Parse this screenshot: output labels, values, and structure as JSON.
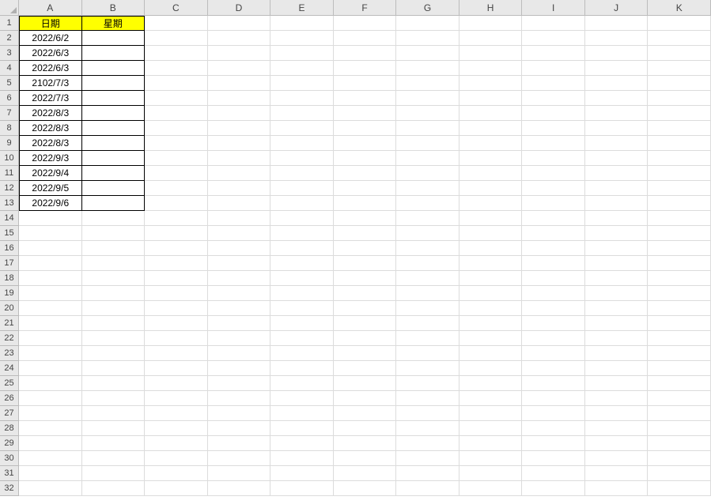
{
  "columns": [
    "A",
    "B",
    "C",
    "D",
    "E",
    "F",
    "G",
    "H",
    "I",
    "J",
    "K"
  ],
  "total_rows": 32,
  "headers": {
    "A": "日期",
    "B": "星期"
  },
  "rows": [
    {
      "A": "2022/6/2",
      "B": ""
    },
    {
      "A": "2022/6/3",
      "B": ""
    },
    {
      "A": "2022/6/3",
      "B": ""
    },
    {
      "A": "2102/7/3",
      "B": ""
    },
    {
      "A": "2022/7/3",
      "B": ""
    },
    {
      "A": "2022/8/3",
      "B": ""
    },
    {
      "A": "2022/8/3",
      "B": ""
    },
    {
      "A": "2022/8/3",
      "B": ""
    },
    {
      "A": "2022/9/3",
      "B": ""
    },
    {
      "A": "2022/9/4",
      "B": ""
    },
    {
      "A": "2022/9/5",
      "B": ""
    },
    {
      "A": "2022/9/6",
      "B": ""
    }
  ],
  "chart_data": {
    "type": "table",
    "title": "",
    "columns": [
      "日期",
      "星期"
    ],
    "data": [
      [
        "2022/6/2",
        ""
      ],
      [
        "2022/6/3",
        ""
      ],
      [
        "2022/6/3",
        ""
      ],
      [
        "2102/7/3",
        ""
      ],
      [
        "2022/7/3",
        ""
      ],
      [
        "2022/8/3",
        ""
      ],
      [
        "2022/8/3",
        ""
      ],
      [
        "2022/8/3",
        ""
      ],
      [
        "2022/9/3",
        ""
      ],
      [
        "2022/9/4",
        ""
      ],
      [
        "2022/9/5",
        ""
      ],
      [
        "2022/9/6",
        ""
      ]
    ]
  }
}
